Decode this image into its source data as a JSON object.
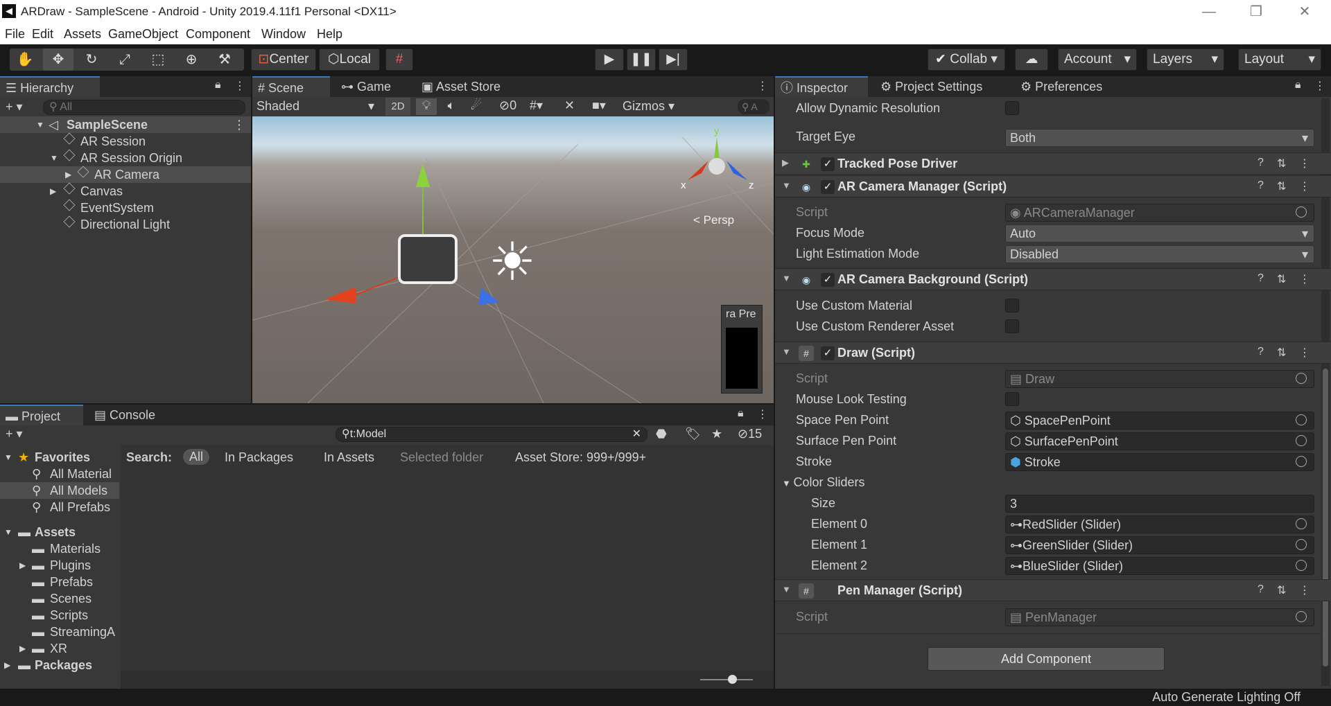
{
  "window": {
    "title": "ARDraw - SampleScene - Android - Unity 2019.4.11f1 Personal <DX11>"
  },
  "menu": [
    "File",
    "Edit",
    "Assets",
    "GameObject",
    "Component",
    "Window",
    "Help"
  ],
  "toolbar": {
    "center": "Center",
    "local": "Local",
    "collab": "Collab",
    "account": "Account",
    "layers": "Layers",
    "layout": "Layout"
  },
  "hierarchy": {
    "tab": "Hierarchy",
    "search_placeholder": "All",
    "scene": "SampleScene",
    "items": [
      "AR Session",
      "AR Session Origin",
      "AR Camera",
      "Canvas",
      "EventSystem",
      "Directional Light"
    ]
  },
  "scene": {
    "tabs": [
      "Scene",
      "Game",
      "Asset Store"
    ],
    "shading": "Shaded",
    "mode2d": "2D",
    "hidden_count": "0",
    "gizmos": "Gizmos",
    "search": "A",
    "persp": "Persp",
    "preview": "ra Pre",
    "axis": {
      "x": "x",
      "y": "y",
      "z": "z"
    }
  },
  "project": {
    "tabs": [
      "Project",
      "Console"
    ],
    "search_value": "t:Model",
    "hidden_count": "15",
    "search_label": "Search:",
    "filters": [
      "All",
      "In Packages",
      "In Assets",
      "Selected folder",
      "Asset Store: 999+/999+"
    ],
    "favorites": "Favorites",
    "fav_items": [
      "All Material",
      "All Models",
      "All Prefabs"
    ],
    "assets": "Assets",
    "asset_items": [
      "Materials",
      "Plugins",
      "Prefabs",
      "Scenes",
      "Scripts",
      "StreamingA",
      "XR"
    ],
    "packages": "Packages"
  },
  "inspector": {
    "tabs": [
      "Inspector",
      "Project Settings",
      "Preferences"
    ],
    "allow_dynamic": "Allow Dynamic Resolution",
    "target_eye": "Target Eye",
    "target_eye_val": "Both",
    "tracked": "Tracked Pose Driver",
    "arcm": "AR Camera Manager (Script)",
    "script": "Script",
    "arcm_script": "ARCameraManager",
    "focus": "Focus Mode",
    "focus_val": "Auto",
    "light": "Light Estimation Mode",
    "light_val": "Disabled",
    "arcb": "AR Camera Background (Script)",
    "use_mat": "Use Custom Material",
    "use_rend": "Use Custom Renderer Asset",
    "draw": "Draw (Script)",
    "draw_script": "Draw",
    "mouse_look": "Mouse Look Testing",
    "space_pen": "Space Pen Point",
    "space_pen_val": "SpacePenPoint",
    "surface_pen": "Surface Pen Point",
    "surface_pen_val": "SurfacePenPoint",
    "stroke": "Stroke",
    "stroke_val": "Stroke",
    "color_sliders": "Color Sliders",
    "size": "Size",
    "size_val": "3",
    "el0": "Element 0",
    "el0_val": "RedSlider (Slider)",
    "el1": "Element 1",
    "el1_val": "GreenSlider (Slider)",
    "el2": "Element 2",
    "el2_val": "BlueSlider (Slider)",
    "pen": "Pen Manager (Script)",
    "pen_script": "PenManager",
    "add": "Add Component"
  },
  "status": "Auto Generate Lighting Off"
}
